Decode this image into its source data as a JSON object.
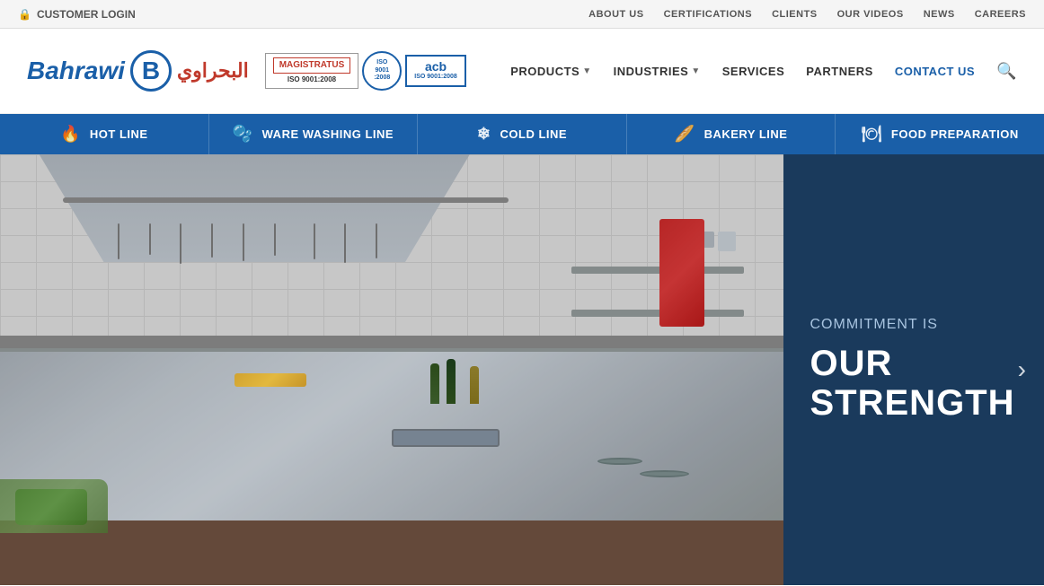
{
  "topbar": {
    "customer_login": "CUSTOMER LOGIN",
    "nav_items": [
      {
        "label": "ABOUT US",
        "href": "#"
      },
      {
        "label": "CERTIFICATIONS",
        "href": "#"
      },
      {
        "label": "CLIENTS",
        "href": "#"
      },
      {
        "label": "OUR VIDEOS",
        "href": "#"
      },
      {
        "label": "NEWS",
        "href": "#"
      },
      {
        "label": "CAREERS",
        "href": "#"
      }
    ]
  },
  "logo": {
    "brand": "Bahrawi",
    "letter": "B",
    "arabic": "البحراوي",
    "cert1": "MAGISTRATUS",
    "cert1_sub": "ISO 9001:2008",
    "cert2_label": "ISO",
    "cert2_sub": "9001:2008",
    "cert3_label": "acb",
    "cert3_sub": "ISO 9001:2008"
  },
  "mainnav": {
    "items": [
      {
        "label": "PRODUCTS",
        "dropdown": true
      },
      {
        "label": "INDUSTRIES",
        "dropdown": true
      },
      {
        "label": "SERVICES",
        "dropdown": false
      },
      {
        "label": "PARTNERS",
        "dropdown": false
      },
      {
        "label": "CONTACT US",
        "dropdown": false,
        "highlight": true
      }
    ]
  },
  "productbar": {
    "items": [
      {
        "label": "HOT LINE",
        "icon": "flame"
      },
      {
        "label": "WARE WASHING LINE",
        "icon": "wash"
      },
      {
        "label": "COLD LINE",
        "icon": "cold"
      },
      {
        "label": "BAKERY LINE",
        "icon": "bakery"
      },
      {
        "label": "FOOD PREPARATION",
        "icon": "prep"
      }
    ]
  },
  "hero": {
    "commitment_label": "COMMITMENT IS",
    "strength_label": "OUR STRENGTH",
    "arrow_label": "›"
  },
  "colors": {
    "primary_blue": "#1a5fa8",
    "dark_navy": "#1a3a5c",
    "accent_red": "#c0392b",
    "bar_blue": "#1a5fa8"
  }
}
